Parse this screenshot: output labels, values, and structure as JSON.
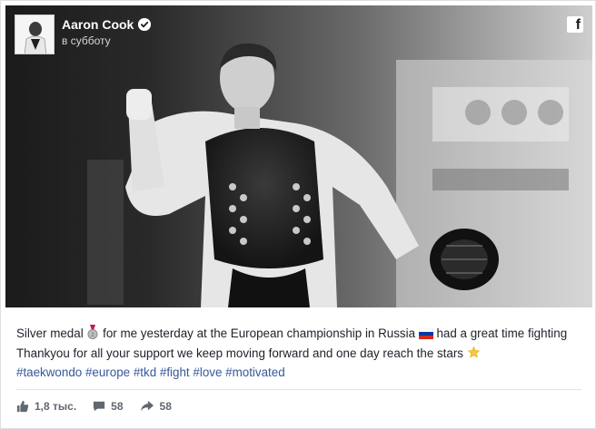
{
  "post": {
    "author": "Aaron Cook",
    "time": "в субботу",
    "caption": {
      "part1": "Silver medal ",
      "part2": " for me yesterday at the European championship in Russia ",
      "part3": " had a great time fighting Thankyou for all your support we keep moving forward and one day reach the stars ",
      "hashtags": [
        "#taekwondo",
        "#europe",
        "#tkd",
        "#fight",
        "#love",
        "#motivated"
      ]
    },
    "stats": {
      "likes": "1,8 тыс.",
      "comments": "58",
      "shares": "58"
    }
  },
  "icons": {
    "verified": "verified-badge-icon",
    "facebook": "facebook-logo-icon",
    "like": "thumbs-up-icon",
    "comment": "comment-bubble-icon",
    "share": "share-arrow-icon"
  },
  "colors": {
    "header_bg": "#1b1b1b",
    "link": "#365899",
    "text": "#1d2129",
    "muted": "#606770"
  }
}
